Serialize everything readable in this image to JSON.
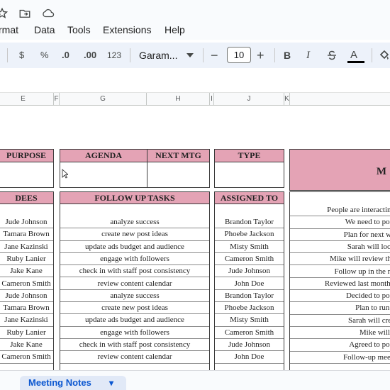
{
  "title_icons": [
    "star-icon",
    "move-to-folder-icon",
    "cloud-status-icon"
  ],
  "menu": {
    "format": "rmat",
    "data": "Data",
    "tools": "Tools",
    "extensions": "Extensions",
    "help": "Help"
  },
  "toolbar": {
    "currency": "$",
    "percent": "%",
    "decrease_decimal": ".0",
    "increase_decimal": ".00",
    "number_format": "123",
    "font": "Garam...",
    "font_size": "10",
    "minus": "−",
    "plus": "+",
    "bold": "B",
    "italic": "I",
    "text_color": "A"
  },
  "columns": [
    "E",
    "F",
    "G",
    "H",
    "I",
    "J",
    "K"
  ],
  "table": {
    "purpose_header": "PURPOSE",
    "agenda_header": "AGENDA",
    "next_mtg_header": "NEXT MTG",
    "type_header": "TYPE",
    "big_header_partial": "M",
    "attendees_header": "DEES",
    "follow_up_header": "FOLLOW UP TASKS",
    "assigned_header": "ASSIGNED TO",
    "attendees": [
      "Jude Johnson",
      "Tamara Brown",
      "Jane Kazinski",
      "Ruby Lanier",
      "Jake Kane",
      "Cameron Smith",
      "Jude Johnson",
      "Tamara Brown",
      "Jane Kazinski",
      "Ruby Lanier",
      "Jake Kane",
      "Cameron Smith"
    ],
    "tasks": [
      "analyze success",
      "create new post ideas",
      "update ads budget and audience",
      "engage with followers",
      "check in with staff post consistency",
      "review content calendar",
      "analyze success",
      "create new post ideas",
      "update ads budget and audience",
      "engage with followers",
      "check in with staff post consistency",
      "review content calendar"
    ],
    "assigned": [
      "Brandon Taylor",
      "Phoebe Jackson",
      "Misty Smith",
      "Cameron Smith",
      "Jude Johnson",
      "John Doe",
      "Brandon Taylor",
      "Phoebe Jackson",
      "Misty Smith",
      "Cameron Smith",
      "Jude Johnson",
      "John Doe"
    ],
    "notes": [
      "People are interacting",
      "We need to post",
      "Plan for next we",
      "Sarah will look",
      "Mike will review the",
      "Follow up in the ne",
      "Reviewed last month's",
      "Decided to post",
      "Plan to run a",
      "Sarah will crea",
      "Mike will s",
      "Agreed to post",
      "Follow-up meeti"
    ]
  },
  "sheet_tab": {
    "label": "Meeting Notes",
    "dropdown": "▾"
  },
  "colors": {
    "header_pink": "#e4a3b5",
    "toolbar_bg": "#edf2fa",
    "tab_blue": "#0b57d0"
  }
}
